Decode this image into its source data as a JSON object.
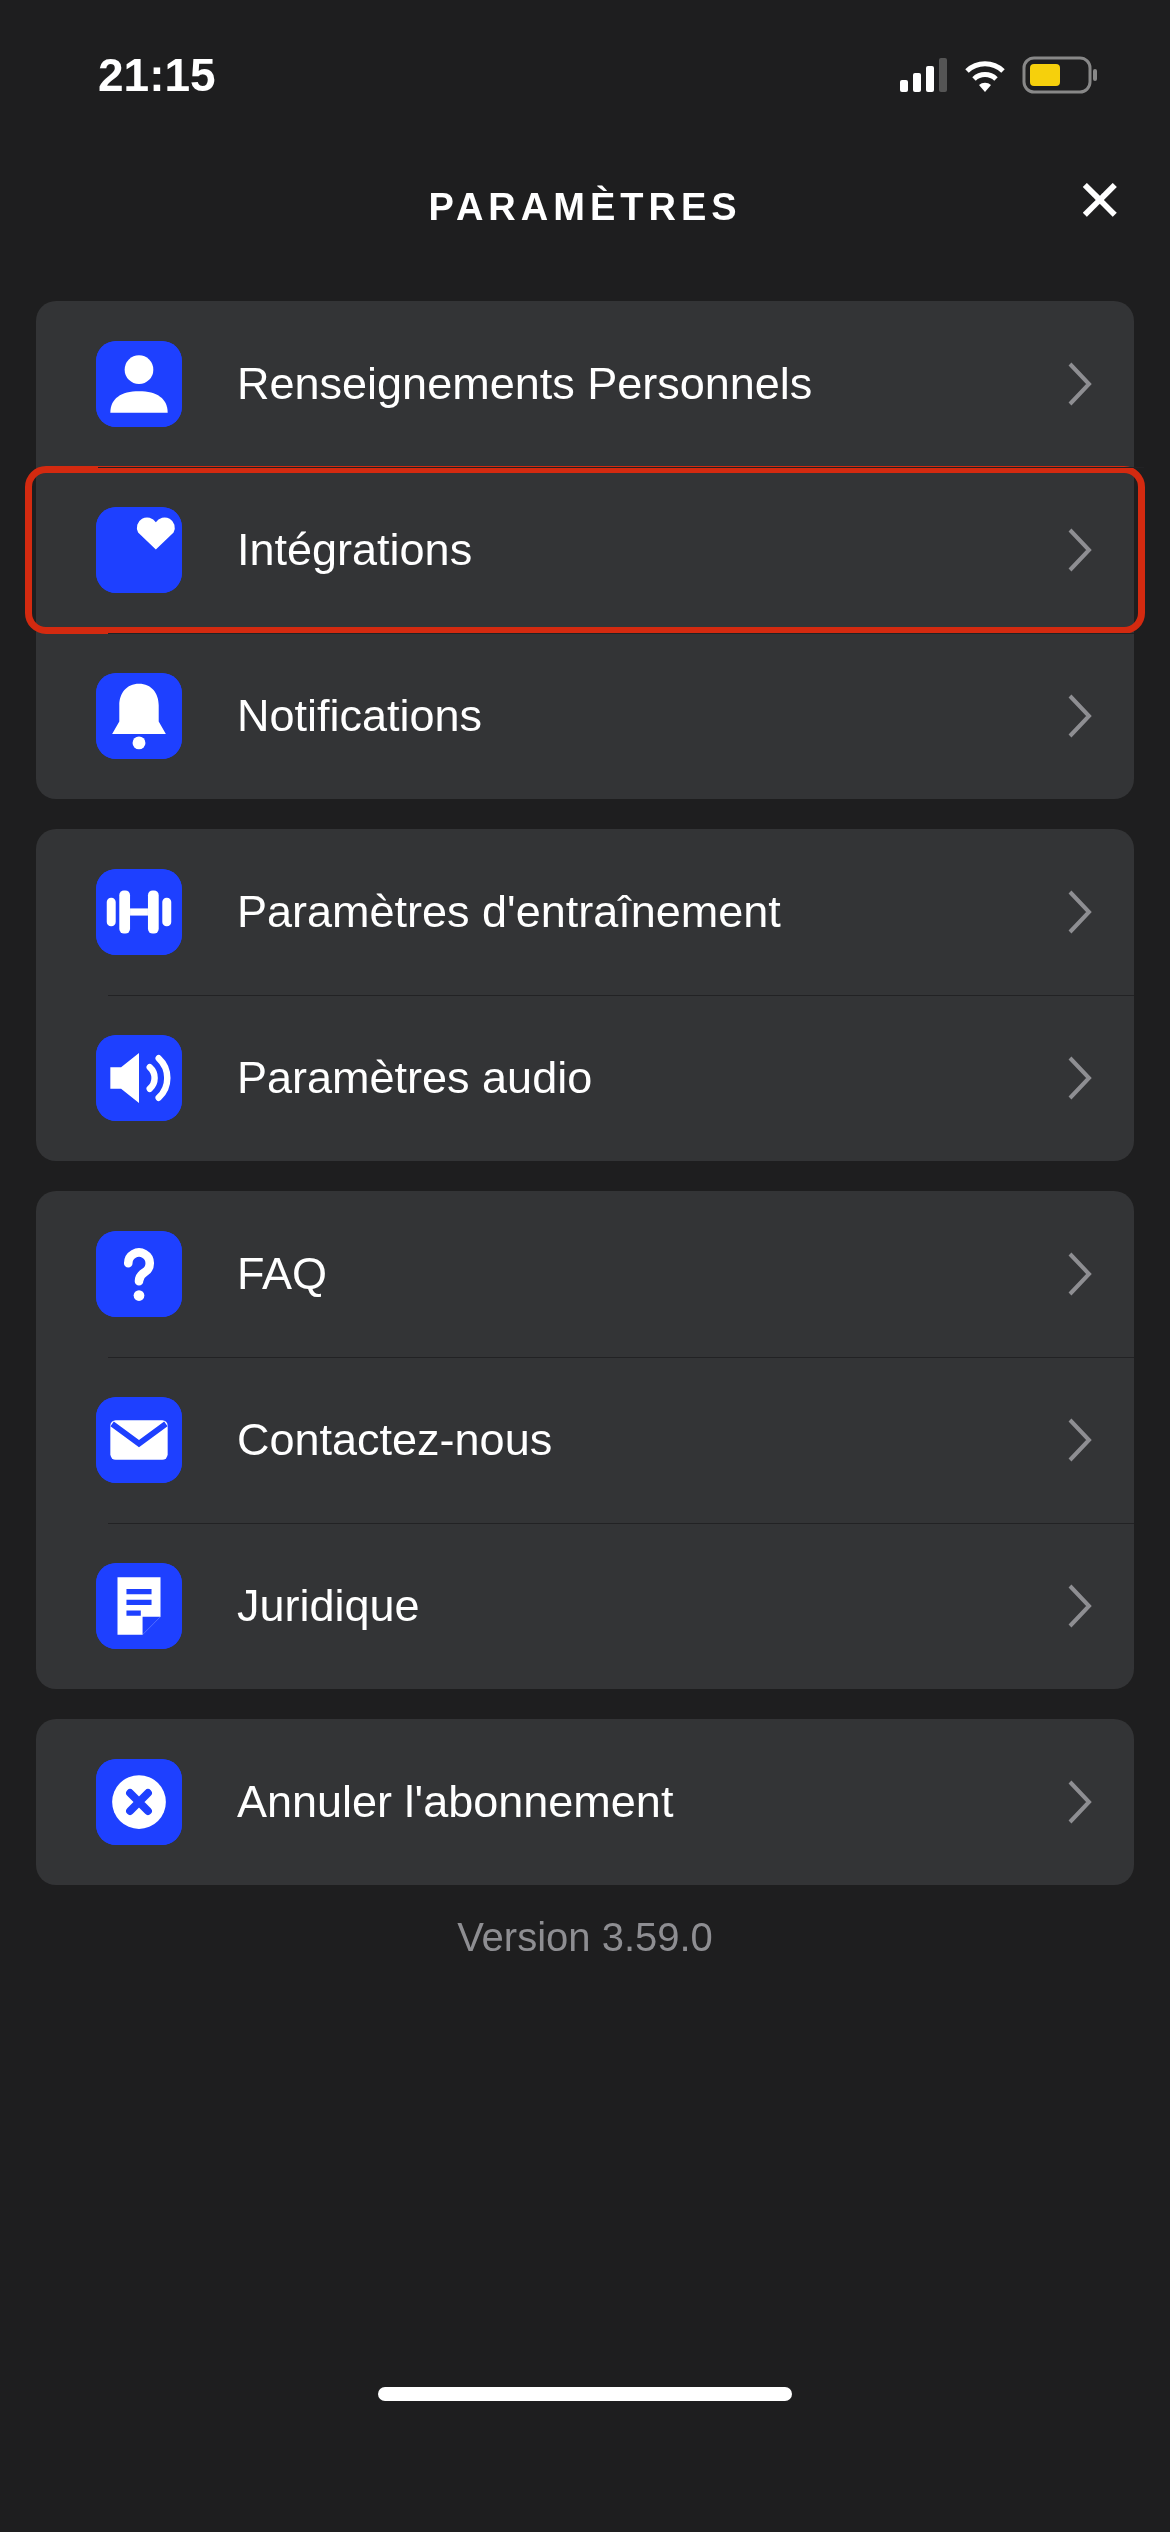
{
  "status_bar": {
    "time": "21:15"
  },
  "header": {
    "title": "PARAMÈTRES",
    "close": "✕"
  },
  "groups": [
    {
      "items": [
        {
          "label": "Renseignements Personnels",
          "highlighted": false
        },
        {
          "label": "Intégrations",
          "highlighted": true
        },
        {
          "label": "Notifications",
          "highlighted": false
        }
      ]
    },
    {
      "items": [
        {
          "label": "Paramètres d'entraînement",
          "highlighted": false
        },
        {
          "label": "Paramètres audio",
          "highlighted": false
        }
      ]
    },
    {
      "items": [
        {
          "label": "FAQ",
          "highlighted": false
        },
        {
          "label": "Contactez-nous",
          "highlighted": false
        },
        {
          "label": "Juridique",
          "highlighted": false
        }
      ]
    },
    {
      "items": [
        {
          "label": "Annuler l'abonnement",
          "highlighted": false
        }
      ]
    }
  ],
  "version": "Version 3.59.0"
}
